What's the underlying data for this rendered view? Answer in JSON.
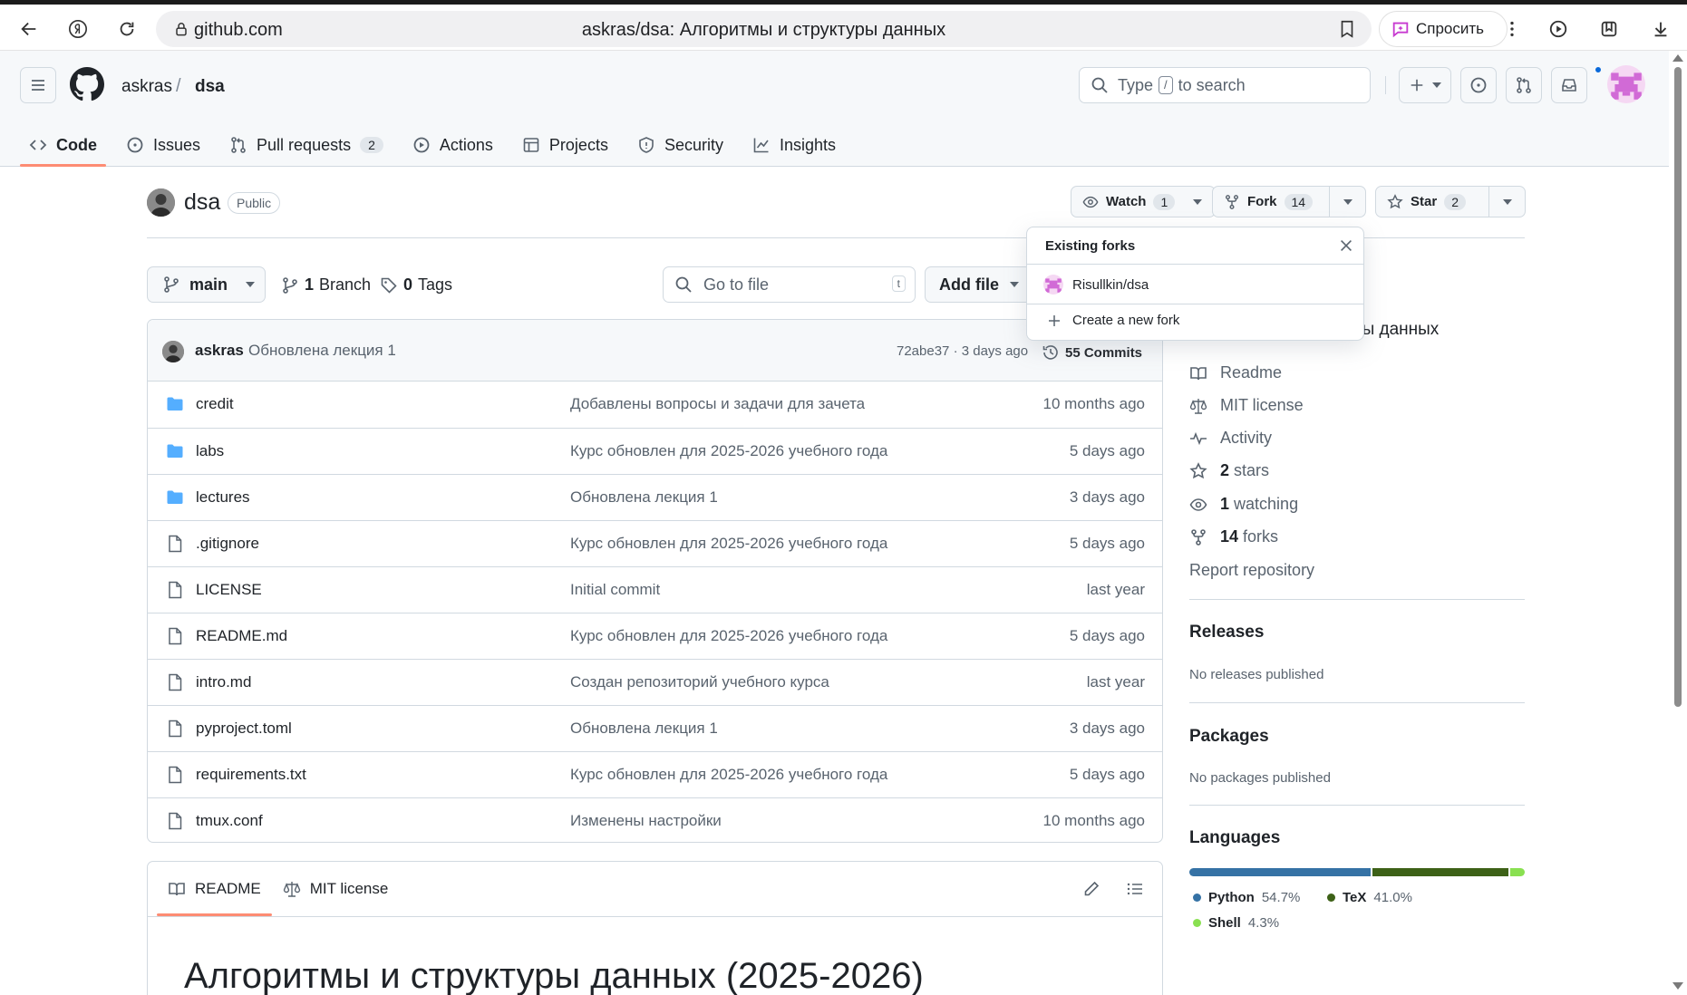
{
  "browser": {
    "host": "github.com",
    "page_title": "askras/dsa: Алгоритмы и структуры данных",
    "ask_label": "Спросить"
  },
  "header": {
    "owner": "askras",
    "separator": "/",
    "repo": "dsa",
    "search_prefix": "Type",
    "search_key": "/",
    "search_suffix": "to search"
  },
  "tabs": [
    {
      "label": "Code",
      "icon": "code-icon"
    },
    {
      "label": "Issues",
      "icon": "issue-icon"
    },
    {
      "label": "Pull requests",
      "icon": "pull-request-icon",
      "count": "2"
    },
    {
      "label": "Actions",
      "icon": "play-icon"
    },
    {
      "label": "Projects",
      "icon": "table-icon"
    },
    {
      "label": "Security",
      "icon": "shield-icon"
    },
    {
      "label": "Insights",
      "icon": "graph-icon"
    }
  ],
  "repo": {
    "name": "dsa",
    "visibility": "Public",
    "watch_label": "Watch",
    "watch_count": "1",
    "fork_label": "Fork",
    "fork_count": "14",
    "star_label": "Star",
    "star_count": "2"
  },
  "branch_bar": {
    "branch": "main",
    "branch_count": "1",
    "branch_label": "Branch",
    "tag_count": "0",
    "tag_label": "Tags",
    "goto_placeholder": "Go to file",
    "goto_key": "t",
    "add_file": "Add file"
  },
  "commit": {
    "user": "askras",
    "message": "Обновлена лекция 1",
    "hash_time": "72abe37 · 3 days ago",
    "count_label": "55 Commits"
  },
  "files": [
    {
      "type": "folder",
      "name": "credit",
      "message": "Добавлены вопросы и задачи для зачета",
      "date": "10 months ago"
    },
    {
      "type": "folder",
      "name": "labs",
      "message": "Курс обновлен для 2025-2026 учебного года",
      "date": "5 days ago"
    },
    {
      "type": "folder",
      "name": "lectures",
      "message": "Обновлена лекция 1",
      "date": "3 days ago"
    },
    {
      "type": "file",
      "name": ".gitignore",
      "message": "Курс обновлен для 2025-2026 учебного года",
      "date": "5 days ago"
    },
    {
      "type": "file",
      "name": "LICENSE",
      "message": "Initial commit",
      "date": "last year"
    },
    {
      "type": "file",
      "name": "README.md",
      "message": "Курс обновлен для 2025-2026 учебного года",
      "date": "5 days ago"
    },
    {
      "type": "file",
      "name": "intro.md",
      "message": "Создан репозиторий учебного курса",
      "date": "last year"
    },
    {
      "type": "file",
      "name": "pyproject.toml",
      "message": "Обновлена лекция 1",
      "date": "3 days ago"
    },
    {
      "type": "file",
      "name": "requirements.txt",
      "message": "Курс обновлен для 2025-2026 учебного года",
      "date": "5 days ago"
    },
    {
      "type": "file",
      "name": "tmux.conf",
      "message": "Изменены настройки",
      "date": "10 months ago"
    }
  ],
  "readme": {
    "tab_readme": "README",
    "tab_license": "MIT license",
    "heading": "Алгоритмы и структуры данных (2025-2026)"
  },
  "sidebar": {
    "about_partial": "ры данных",
    "links": [
      {
        "icon": "book-icon",
        "label": "Readme"
      },
      {
        "icon": "law-icon",
        "label": "MIT license"
      },
      {
        "icon": "pulse-icon",
        "label": "Activity"
      },
      {
        "icon": "star-icon",
        "count": "2",
        "label": "stars"
      },
      {
        "icon": "eye-icon",
        "count": "1",
        "label": "watching"
      },
      {
        "icon": "repo-forked-icon",
        "count": "14",
        "label": "forks"
      }
    ],
    "report": "Report repository",
    "releases_title": "Releases",
    "releases_note": "No releases published",
    "packages_title": "Packages",
    "packages_note": "No packages published",
    "languages_title": "Languages",
    "languages": [
      {
        "name": "Python",
        "percent": "54.7%",
        "value": 54.7,
        "color": "#3572A5"
      },
      {
        "name": "TeX",
        "percent": "41.0%",
        "value": 41.0,
        "color": "#3D6117"
      },
      {
        "name": "Shell",
        "percent": "4.3%",
        "value": 4.3,
        "color": "#89e051"
      }
    ]
  },
  "fork_popover": {
    "title": "Existing forks",
    "fork_item": "Risullkin/dsa",
    "create_label": "Create a new fork"
  },
  "colors": {
    "accent_tab": "#fd8c73",
    "link_blue": "#0969da",
    "folder_blue": "#54aeff"
  }
}
